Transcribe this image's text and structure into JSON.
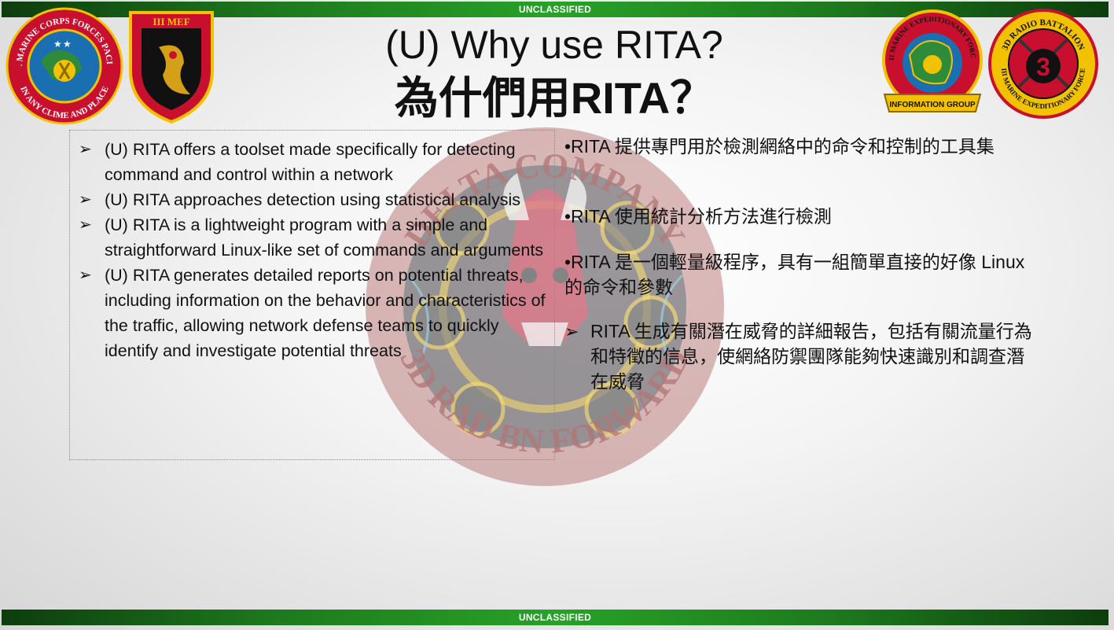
{
  "banner": {
    "top": "UNCLASSIFIED",
    "bottom": "UNCLASSIFIED"
  },
  "title": {
    "line1": "(U) Why use RITA?",
    "line2": "為什們用RITA？"
  },
  "left_bullets": [
    "(U) RITA offers a toolset made specifically for detecting command and control within a network",
    "(U) RITA approaches detection using statistical analysis",
    "(U) RITA is a lightweight program with a simple and straightforward Linux-like set of commands and arguments",
    "(U) RITA generates detailed reports on potential threats, including information on the behavior and characteristics of the traffic, allowing network defense teams to quickly identify and investigate potential threats"
  ],
  "right_paragraphs": [
    "•RITA 提供專門用於檢測網絡中的命令和控制的工具集",
    "•RITA 使用統計分析方法進行檢測",
    "•RITA 是一個輕量級程序，具有一組簡單直接的好像 Linux 的命令和參數",
    "RITA 生成有關潛在威脅的詳細報告，包括有關流量行為和特徵的信息，使網絡防禦團隊能夠快速識別和調查潛在威脅"
  ],
  "logos": {
    "marforpac": {
      "outer_text": "U.S. MARINE CORPS FORCES PACIFIC",
      "inner_text": "IN ANY CLIME AND PLACE"
    },
    "iiimef": {
      "text": "III MEF"
    },
    "mig": {
      "outer_text": "III MARINE EXPEDITIONARY FORCE",
      "band_text": "INFORMATION GROUP"
    },
    "radbn": {
      "outer_text": "3D RADIO BATTALION",
      "bottom_text": "III MARINE EXPEDITIONARY FORCE",
      "number": "3"
    },
    "watermark": {
      "top_text": "DELTA COMPANY",
      "bottom_text": "3D RAD BN FORWARD"
    }
  },
  "colors": {
    "banner_green": "#1d7a1d",
    "marine_red": "#c8102e",
    "gold": "#f2c200"
  }
}
